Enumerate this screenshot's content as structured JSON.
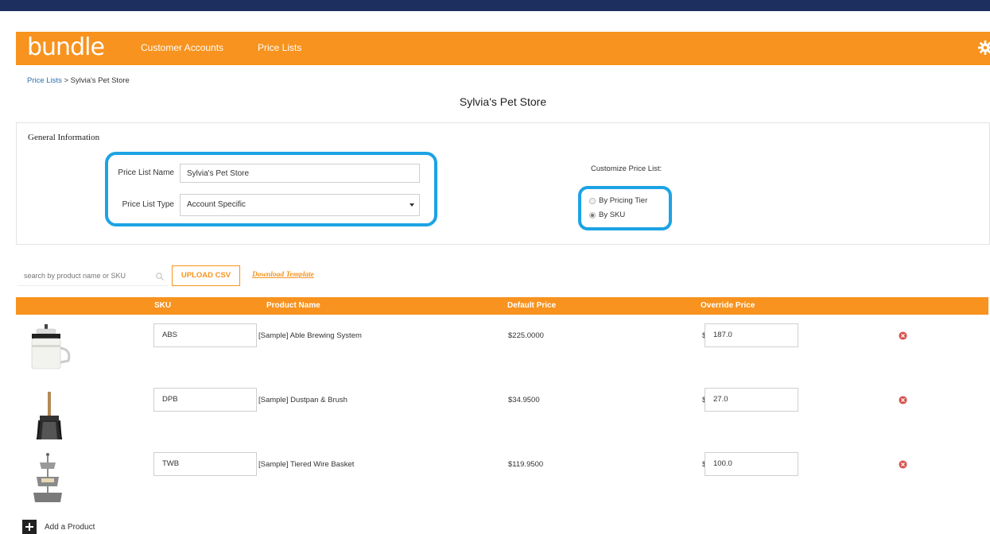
{
  "app": {
    "logo_text": "bundle",
    "nav": [
      {
        "label": "Customer Accounts"
      },
      {
        "label": "Price Lists"
      }
    ]
  },
  "breadcrumb": {
    "parent": "Price Lists",
    "separator": " > ",
    "current": "Sylvia's Pet Store"
  },
  "page": {
    "title": "Sylvia's Pet Store"
  },
  "general": {
    "title": "General Information",
    "name_label": "Price List Name",
    "name_value": "Sylvia's Pet Store",
    "type_label": "Price List Type",
    "type_value": "Account Specific",
    "customize_label": "Customize Price List:",
    "options": [
      {
        "label": "By Pricing Tier",
        "selected": false
      },
      {
        "label": "By SKU",
        "selected": true
      }
    ]
  },
  "toolbar": {
    "search_placeholder": "search by product name or SKU",
    "upload_label": "UPLOAD CSV",
    "download_label": "Download Template"
  },
  "table": {
    "columns": [
      "SKU",
      "Product Name",
      "Default Price",
      "Override Price"
    ],
    "currency_symbol": "$",
    "rows": [
      {
        "sku": "ABS",
        "name": "[Sample] Able Brewing System",
        "default_price": "$225.0000",
        "override": "187.0",
        "image": "brewing-system"
      },
      {
        "sku": "DPB",
        "name": "[Sample] Dustpan & Brush",
        "default_price": "$34.9500",
        "override": "27.0",
        "image": "dustpan-brush"
      },
      {
        "sku": "TWB",
        "name": "[Sample] Tiered Wire Basket",
        "default_price": "$119.9500",
        "override": "100.0",
        "image": "tiered-basket"
      }
    ]
  },
  "add_product_label": "Add a Product",
  "colors": {
    "brand_orange": "#f7931e",
    "top_bar": "#1d2f5e",
    "highlight": "#1ca3e4",
    "remove_red": "#d9534f"
  }
}
